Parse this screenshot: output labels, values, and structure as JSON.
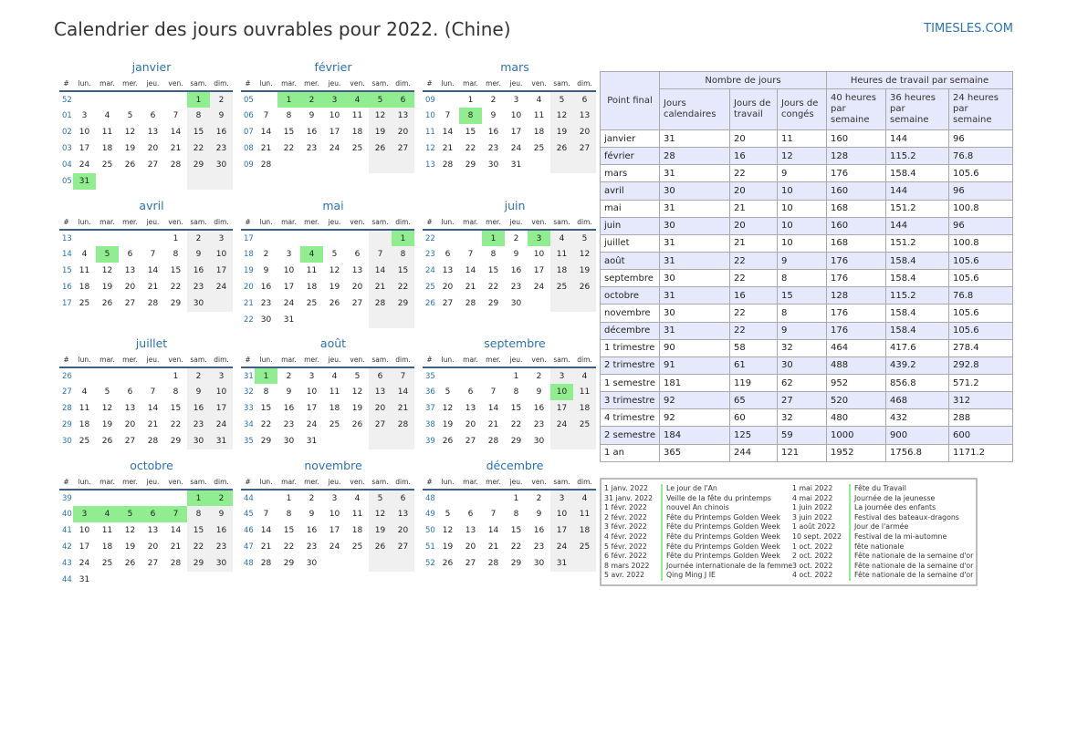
{
  "title": "Calendrier des jours ouvrables pour 2022. (Chine)",
  "site": "TIMESLES.COM",
  "day_headers": [
    "#",
    "lun.",
    "mar.",
    "mer.",
    "jeu.",
    "ven.",
    "sam.",
    "dim."
  ],
  "colors": {
    "accent": "#2a72b5",
    "holiday": "#90ee90",
    "weekend": "#f0f0f0",
    "header_bg": "#e6e8fb",
    "rule": "#3d5f86"
  },
  "months": [
    {
      "name": "janvier",
      "weeks": [
        {
          "w": "52",
          "d": [
            "",
            "",
            "",
            "",
            "",
            "1",
            "2"
          ],
          "h": [
            5
          ]
        },
        {
          "w": "01",
          "d": [
            "3",
            "4",
            "5",
            "6",
            "7",
            "8",
            "9"
          ]
        },
        {
          "w": "02",
          "d": [
            "10",
            "11",
            "12",
            "13",
            "14",
            "15",
            "16"
          ]
        },
        {
          "w": "03",
          "d": [
            "17",
            "18",
            "19",
            "20",
            "21",
            "22",
            "23"
          ]
        },
        {
          "w": "04",
          "d": [
            "24",
            "25",
            "26",
            "27",
            "28",
            "29",
            "30"
          ]
        },
        {
          "w": "05",
          "d": [
            "31",
            "",
            "",
            "",
            "",
            "",
            ""
          ],
          "h": [
            0
          ]
        }
      ]
    },
    {
      "name": "février",
      "weeks": [
        {
          "w": "05",
          "d": [
            "",
            "1",
            "2",
            "3",
            "4",
            "5",
            "6"
          ],
          "h": [
            1,
            2,
            3,
            4,
            5,
            6
          ]
        },
        {
          "w": "06",
          "d": [
            "7",
            "8",
            "9",
            "10",
            "11",
            "12",
            "13"
          ]
        },
        {
          "w": "07",
          "d": [
            "14",
            "15",
            "16",
            "17",
            "18",
            "19",
            "20"
          ]
        },
        {
          "w": "08",
          "d": [
            "21",
            "22",
            "23",
            "24",
            "25",
            "26",
            "27"
          ]
        },
        {
          "w": "09",
          "d": [
            "28",
            "",
            "",
            "",
            "",
            "",
            ""
          ]
        }
      ]
    },
    {
      "name": "mars",
      "weeks": [
        {
          "w": "09",
          "d": [
            "",
            "1",
            "2",
            "3",
            "4",
            "5",
            "6"
          ]
        },
        {
          "w": "10",
          "d": [
            "7",
            "8",
            "9",
            "10",
            "11",
            "12",
            "13"
          ],
          "h": [
            1
          ]
        },
        {
          "w": "11",
          "d": [
            "14",
            "15",
            "16",
            "17",
            "18",
            "19",
            "20"
          ]
        },
        {
          "w": "12",
          "d": [
            "21",
            "22",
            "23",
            "24",
            "25",
            "26",
            "27"
          ]
        },
        {
          "w": "13",
          "d": [
            "28",
            "29",
            "30",
            "31",
            "",
            "",
            ""
          ]
        }
      ]
    },
    {
      "name": "avril",
      "weeks": [
        {
          "w": "13",
          "d": [
            "",
            "",
            "",
            "",
            "1",
            "2",
            "3"
          ]
        },
        {
          "w": "14",
          "d": [
            "4",
            "5",
            "6",
            "7",
            "8",
            "9",
            "10"
          ],
          "h": [
            1
          ]
        },
        {
          "w": "15",
          "d": [
            "11",
            "12",
            "13",
            "14",
            "15",
            "16",
            "17"
          ]
        },
        {
          "w": "16",
          "d": [
            "18",
            "19",
            "20",
            "21",
            "22",
            "23",
            "24"
          ]
        },
        {
          "w": "17",
          "d": [
            "25",
            "26",
            "27",
            "28",
            "29",
            "30",
            ""
          ]
        }
      ]
    },
    {
      "name": "mai",
      "weeks": [
        {
          "w": "17",
          "d": [
            "",
            "",
            "",
            "",
            "",
            "",
            "1"
          ],
          "h": [
            6
          ]
        },
        {
          "w": "18",
          "d": [
            "2",
            "3",
            "4",
            "5",
            "6",
            "7",
            "8"
          ],
          "h": [
            2
          ]
        },
        {
          "w": "19",
          "d": [
            "9",
            "10",
            "11",
            "12",
            "13",
            "14",
            "15"
          ]
        },
        {
          "w": "20",
          "d": [
            "16",
            "17",
            "18",
            "19",
            "20",
            "21",
            "22"
          ]
        },
        {
          "w": "21",
          "d": [
            "23",
            "24",
            "25",
            "26",
            "27",
            "28",
            "29"
          ]
        },
        {
          "w": "22",
          "d": [
            "30",
            "31",
            "",
            "",
            "",
            "",
            ""
          ]
        }
      ]
    },
    {
      "name": "juin",
      "weeks": [
        {
          "w": "22",
          "d": [
            "",
            "",
            "1",
            "2",
            "3",
            "4",
            "5"
          ],
          "h": [
            2,
            4
          ]
        },
        {
          "w": "23",
          "d": [
            "6",
            "7",
            "8",
            "9",
            "10",
            "11",
            "12"
          ]
        },
        {
          "w": "24",
          "d": [
            "13",
            "14",
            "15",
            "16",
            "17",
            "18",
            "19"
          ]
        },
        {
          "w": "25",
          "d": [
            "20",
            "21",
            "22",
            "23",
            "24",
            "25",
            "26"
          ]
        },
        {
          "w": "26",
          "d": [
            "27",
            "28",
            "29",
            "30",
            "",
            "",
            ""
          ]
        }
      ]
    },
    {
      "name": "juillet",
      "weeks": [
        {
          "w": "26",
          "d": [
            "",
            "",
            "",
            "",
            "1",
            "2",
            "3"
          ]
        },
        {
          "w": "27",
          "d": [
            "4",
            "5",
            "6",
            "7",
            "8",
            "9",
            "10"
          ]
        },
        {
          "w": "28",
          "d": [
            "11",
            "12",
            "13",
            "14",
            "15",
            "16",
            "17"
          ]
        },
        {
          "w": "29",
          "d": [
            "18",
            "19",
            "20",
            "21",
            "22",
            "23",
            "24"
          ]
        },
        {
          "w": "30",
          "d": [
            "25",
            "26",
            "27",
            "28",
            "29",
            "30",
            "31"
          ]
        }
      ]
    },
    {
      "name": "août",
      "weeks": [
        {
          "w": "31",
          "d": [
            "1",
            "2",
            "3",
            "4",
            "5",
            "6",
            "7"
          ],
          "h": [
            0
          ]
        },
        {
          "w": "32",
          "d": [
            "8",
            "9",
            "10",
            "11",
            "12",
            "13",
            "14"
          ]
        },
        {
          "w": "33",
          "d": [
            "15",
            "16",
            "17",
            "18",
            "19",
            "20",
            "21"
          ]
        },
        {
          "w": "34",
          "d": [
            "22",
            "23",
            "24",
            "25",
            "26",
            "27",
            "28"
          ]
        },
        {
          "w": "35",
          "d": [
            "29",
            "30",
            "31",
            "",
            "",
            "",
            ""
          ]
        }
      ]
    },
    {
      "name": "septembre",
      "weeks": [
        {
          "w": "35",
          "d": [
            "",
            "",
            "",
            "1",
            "2",
            "3",
            "4"
          ]
        },
        {
          "w": "36",
          "d": [
            "5",
            "6",
            "7",
            "8",
            "9",
            "10",
            "11"
          ],
          "h": [
            5
          ]
        },
        {
          "w": "37",
          "d": [
            "12",
            "13",
            "14",
            "15",
            "16",
            "17",
            "18"
          ]
        },
        {
          "w": "38",
          "d": [
            "19",
            "20",
            "21",
            "22",
            "23",
            "24",
            "25"
          ]
        },
        {
          "w": "39",
          "d": [
            "26",
            "27",
            "28",
            "29",
            "30",
            "",
            ""
          ]
        }
      ]
    },
    {
      "name": "octobre",
      "weeks": [
        {
          "w": "39",
          "d": [
            "",
            "",
            "",
            "",
            "",
            "1",
            "2"
          ],
          "h": [
            5,
            6
          ]
        },
        {
          "w": "40",
          "d": [
            "3",
            "4",
            "5",
            "6",
            "7",
            "8",
            "9"
          ],
          "h": [
            0,
            1,
            2,
            3,
            4
          ]
        },
        {
          "w": "41",
          "d": [
            "10",
            "11",
            "12",
            "13",
            "14",
            "15",
            "16"
          ]
        },
        {
          "w": "42",
          "d": [
            "17",
            "18",
            "19",
            "20",
            "21",
            "22",
            "23"
          ]
        },
        {
          "w": "43",
          "d": [
            "24",
            "25",
            "26",
            "27",
            "28",
            "29",
            "30"
          ]
        },
        {
          "w": "44",
          "d": [
            "31",
            "",
            "",
            "",
            "",
            "",
            ""
          ],
          "blank": true
        }
      ]
    },
    {
      "name": "novembre",
      "weeks": [
        {
          "w": "44",
          "d": [
            "",
            "1",
            "2",
            "3",
            "4",
            "5",
            "6"
          ]
        },
        {
          "w": "45",
          "d": [
            "7",
            "8",
            "9",
            "10",
            "11",
            "12",
            "13"
          ]
        },
        {
          "w": "46",
          "d": [
            "14",
            "15",
            "16",
            "17",
            "18",
            "19",
            "20"
          ]
        },
        {
          "w": "47",
          "d": [
            "21",
            "22",
            "23",
            "24",
            "25",
            "26",
            "27"
          ]
        },
        {
          "w": "48",
          "d": [
            "28",
            "29",
            "30",
            "",
            "",
            "",
            ""
          ]
        }
      ]
    },
    {
      "name": "décembre",
      "weeks": [
        {
          "w": "48",
          "d": [
            "",
            "",
            "",
            "1",
            "2",
            "3",
            "4"
          ]
        },
        {
          "w": "49",
          "d": [
            "5",
            "6",
            "7",
            "8",
            "9",
            "10",
            "11"
          ]
        },
        {
          "w": "50",
          "d": [
            "12",
            "13",
            "14",
            "15",
            "16",
            "17",
            "18"
          ]
        },
        {
          "w": "51",
          "d": [
            "19",
            "20",
            "21",
            "22",
            "23",
            "24",
            "25"
          ]
        },
        {
          "w": "52",
          "d": [
            "26",
            "27",
            "28",
            "29",
            "30",
            "31",
            ""
          ]
        }
      ]
    }
  ],
  "summary": {
    "col_final": "Point final",
    "group_days": "Nombre de jours",
    "group_hours": "Heures de travail par semaine",
    "sub": [
      "Jours calendaires",
      "Jours de travail",
      "Jours de congés",
      "40 heures par semaine",
      "36 heures par semaine",
      "24 heures par semaine"
    ],
    "rows": [
      [
        "janvier",
        "31",
        "20",
        "11",
        "160",
        "144",
        "96"
      ],
      [
        "février",
        "28",
        "16",
        "12",
        "128",
        "115.2",
        "76.8"
      ],
      [
        "mars",
        "31",
        "22",
        "9",
        "176",
        "158.4",
        "105.6"
      ],
      [
        "avril",
        "30",
        "20",
        "10",
        "160",
        "144",
        "96"
      ],
      [
        "mai",
        "31",
        "21",
        "10",
        "168",
        "151.2",
        "100.8"
      ],
      [
        "juin",
        "30",
        "20",
        "10",
        "160",
        "144",
        "96"
      ],
      [
        "juillet",
        "31",
        "21",
        "10",
        "168",
        "151.2",
        "100.8"
      ],
      [
        "août",
        "31",
        "22",
        "9",
        "176",
        "158.4",
        "105.6"
      ],
      [
        "septembre",
        "30",
        "22",
        "8",
        "176",
        "158.4",
        "105.6"
      ],
      [
        "octobre",
        "31",
        "16",
        "15",
        "128",
        "115.2",
        "76.8"
      ],
      [
        "novembre",
        "30",
        "22",
        "8",
        "176",
        "158.4",
        "105.6"
      ],
      [
        "décembre",
        "31",
        "22",
        "9",
        "176",
        "158.4",
        "105.6"
      ],
      [
        "1 trimestre",
        "90",
        "58",
        "32",
        "464",
        "417.6",
        "278.4"
      ],
      [
        "2 trimestre",
        "91",
        "61",
        "30",
        "488",
        "439.2",
        "292.8"
      ],
      [
        "1 semestre",
        "181",
        "119",
        "62",
        "952",
        "856.8",
        "571.2"
      ],
      [
        "3 trimestre",
        "92",
        "65",
        "27",
        "520",
        "468",
        "312"
      ],
      [
        "4 trimestre",
        "92",
        "60",
        "32",
        "480",
        "432",
        "288"
      ],
      [
        "2 semestre",
        "184",
        "125",
        "59",
        "1000",
        "900",
        "600"
      ],
      [
        "1 an",
        "365",
        "244",
        "121",
        "1952",
        "1756.8",
        "1171.2"
      ]
    ]
  },
  "holidays": [
    [
      {
        "date": "1 janv. 2022",
        "name": "Le jour de l'An"
      },
      {
        "date": "31 janv. 2022",
        "name": "Veille de la fête du printemps"
      },
      {
        "date": "1 févr. 2022",
        "name": "nouvel An chinois"
      },
      {
        "date": "2 févr. 2022",
        "name": "Fête du Printemps Golden Week"
      },
      {
        "date": "3 févr. 2022",
        "name": "Fête du Printemps Golden Week"
      },
      {
        "date": "4 févr. 2022",
        "name": "Fête du Printemps Golden Week"
      },
      {
        "date": "5 févr. 2022",
        "name": "Fête du Printemps Golden Week"
      },
      {
        "date": "6 févr. 2022",
        "name": "Fête du Printemps Golden Week"
      },
      {
        "date": "8 mars 2022",
        "name": "Journée internationale de la femme"
      },
      {
        "date": "5 avr. 2022",
        "name": "Qing Ming J IE"
      }
    ],
    [
      {
        "date": "1 mai 2022",
        "name": "Fête du Travail"
      },
      {
        "date": "4 mai 2022",
        "name": "Journée de la jeunesse"
      },
      {
        "date": "1 juin 2022",
        "name": "La journée des enfants"
      },
      {
        "date": "3 juin 2022",
        "name": "Festival des bateaux-dragons"
      },
      {
        "date": "1 août 2022",
        "name": "Jour de l'armée"
      },
      {
        "date": "10 sept. 2022",
        "name": "Festival de la mi-automne"
      },
      {
        "date": "1 oct. 2022",
        "name": "fête nationale"
      },
      {
        "date": "2 oct. 2022",
        "name": "Fête nationale de la semaine d'or"
      },
      {
        "date": "3 oct. 2022",
        "name": "Fête nationale de la semaine d'or"
      },
      {
        "date": "4 oct. 2022",
        "name": "Fête nationale de la semaine d'or"
      }
    ]
  ]
}
